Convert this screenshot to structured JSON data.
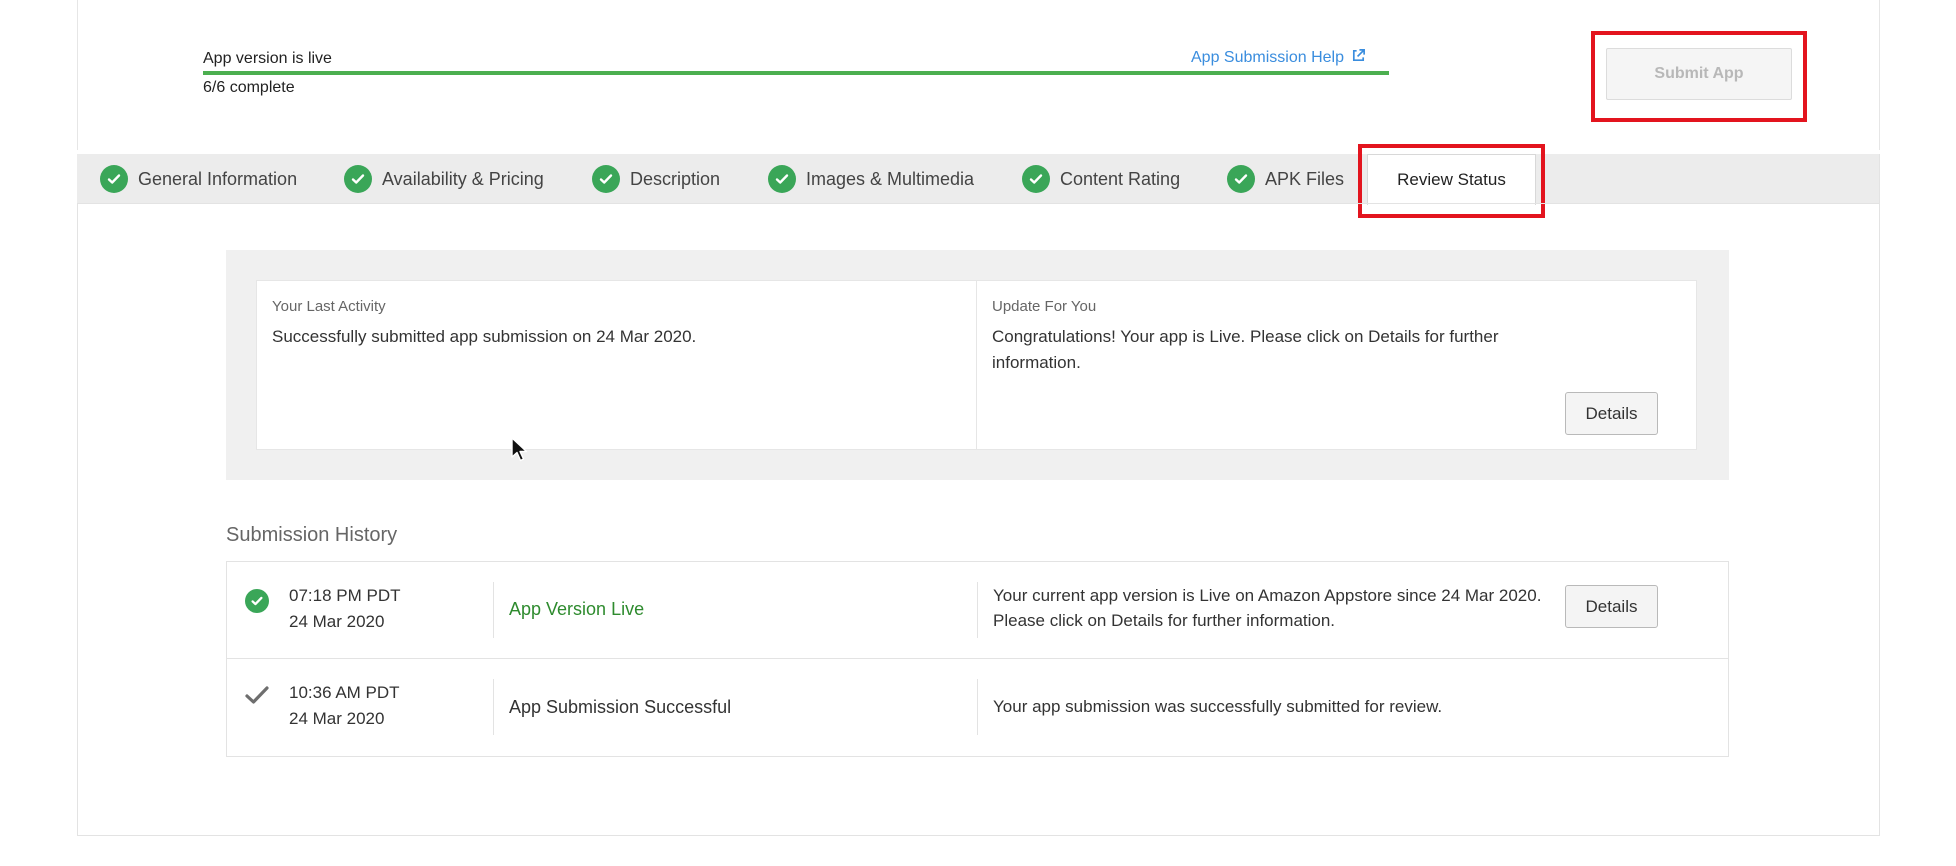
{
  "header": {
    "status_title": "App version is live",
    "progress_text": "6/6 complete",
    "progress_fraction": 1.0,
    "help_link": "App Submission Help",
    "submit_button": "Submit App"
  },
  "tabs": [
    {
      "label": "General Information",
      "complete": true
    },
    {
      "label": "Availability & Pricing",
      "complete": true
    },
    {
      "label": "Description",
      "complete": true
    },
    {
      "label": "Images & Multimedia",
      "complete": true
    },
    {
      "label": "Content Rating",
      "complete": true
    },
    {
      "label": "APK Files",
      "complete": true
    },
    {
      "label": "Review Status",
      "active": true
    }
  ],
  "activity": {
    "last_label": "Your Last Activity",
    "last_text": "Successfully submitted app submission on 24 Mar 2020.",
    "update_label": "Update For You",
    "update_text": "Congratulations! Your app is Live. Please click on Details for further information.",
    "details_button": "Details"
  },
  "history": {
    "title": "Submission History",
    "rows": [
      {
        "time": "07:18 PM PDT",
        "date": "24 Mar 2020",
        "status": "App Version Live",
        "description": "Your current app version is Live on Amazon Appstore since 24 Mar 2020. Please click on Details for further information.",
        "details_button": "Details"
      },
      {
        "time": "10:36 AM PDT",
        "date": "24 Mar 2020",
        "status": "App Submission Successful",
        "description": "Your app submission was successfully submitted for review."
      }
    ]
  },
  "colors": {
    "success_green": "#3aa658",
    "live_text_green": "#2e8b2e",
    "link_blue": "#3a8dde",
    "highlight_red": "#e3141e"
  }
}
